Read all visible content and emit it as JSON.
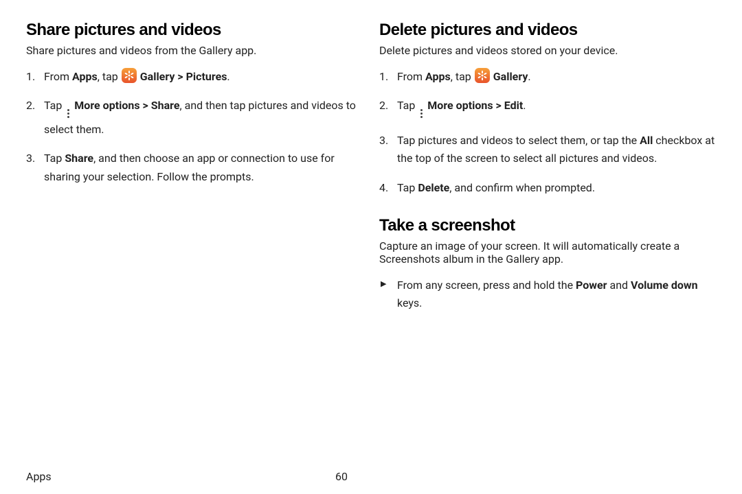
{
  "left": {
    "heading": "Share pictures and videos",
    "intro": "Share pictures and videos from the Gallery app.",
    "steps": {
      "s1_a": "From ",
      "s1_b": "Apps",
      "s1_c": ", tap ",
      "s1_d": "Gallery",
      "s1_e": " > ",
      "s1_f": "Pictures",
      "s1_g": ".",
      "s2_a": "Tap ",
      "s2_b": "More options",
      "s2_c": " > ",
      "s2_d": "Share",
      "s2_e": ", and then tap pictures and videos to select them.",
      "s3_a": "Tap ",
      "s3_b": "Share",
      "s3_c": ", and then choose an app or connection to use for sharing your selection. Follow the prompts."
    }
  },
  "right": {
    "heading": "Delete pictures and videos",
    "intro": "Delete pictures and videos stored on your device.",
    "steps": {
      "s1_a": "From ",
      "s1_b": "Apps",
      "s1_c": ", tap ",
      "s1_d": "Gallery",
      "s1_e": ".",
      "s2_a": "Tap ",
      "s2_b": "More options",
      "s2_c": " > ",
      "s2_d": "Edit",
      "s2_e": ".",
      "s3_a": "Tap pictures and videos to select them, or tap the ",
      "s3_b": "All",
      "s3_c": " checkbox at the top of the screen to select all pictures and videos.",
      "s4_a": "Tap ",
      "s4_b": "Delete",
      "s4_c": ", and confirm when prompted."
    },
    "screenshot": {
      "heading": "Take a screenshot",
      "intro": "Capture an image of your screen. It will automatically create a Screenshots album in the Gallery app.",
      "b1_a": "From any screen, press and hold the ",
      "b1_b": "Power",
      "b1_c": " and ",
      "b1_d": "Volume down",
      "b1_e": " keys."
    }
  },
  "footer": {
    "section": "Apps",
    "page": "60"
  }
}
